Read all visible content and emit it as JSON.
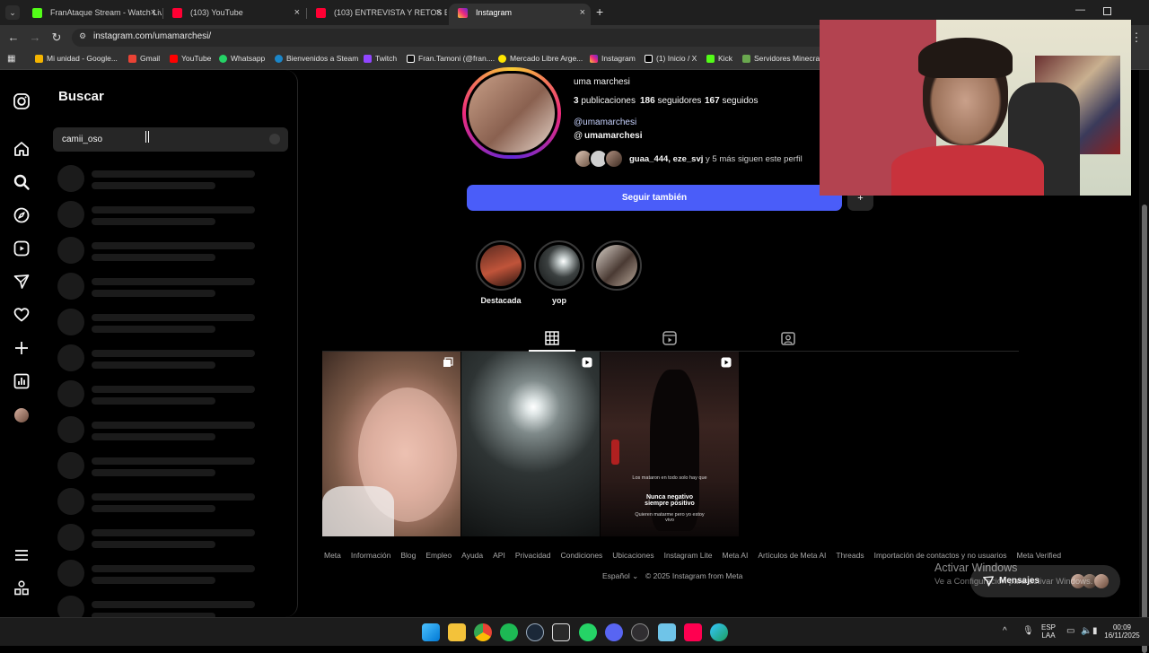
{
  "browser": {
    "tabs": [
      {
        "label": "FranAtaque Stream - Watch Liv",
        "color": "#53fc18"
      },
      {
        "label": "(103) YouTube",
        "color": "#ff0033"
      },
      {
        "label": "(103) ENTREVISTA Y RETOS EN",
        "color": "#ff0033"
      },
      {
        "label": "Instagram",
        "color": "#e1306c"
      }
    ],
    "url": "instagram.com/umamarchesi/",
    "bookmarks": [
      {
        "label": "Mi unidad - Google...",
        "color": "#f4b400"
      },
      {
        "label": "Gmail",
        "color": "#ea4335"
      },
      {
        "label": "YouTube",
        "color": "#ff0000"
      },
      {
        "label": "Whatsapp",
        "color": "#25d366"
      },
      {
        "label": "Bienvenidos a Steam",
        "color": "#1b86c8"
      },
      {
        "label": "Twitch",
        "color": "#9146ff"
      },
      {
        "label": "Fran.Tamoni (@fran....",
        "color": "#ffffff"
      },
      {
        "label": "Mercado Libre Arge...",
        "color": "#ffe600"
      },
      {
        "label": "Instagram",
        "color": "#e1306c"
      },
      {
        "label": "(1) Inicio / X",
        "color": "#ffffff"
      },
      {
        "label": "Kick",
        "color": "#53fc18"
      },
      {
        "label": "Servidores Minecraf...",
        "color": "#6aa84f"
      }
    ]
  },
  "search": {
    "title": "Buscar",
    "query": "camii_oso"
  },
  "profile": {
    "name": "uma marchesi",
    "posts_count": "3",
    "posts_label": "publicaciones",
    "followers_count": "186",
    "followers_label": "seguidores",
    "following_count": "167",
    "following_label": "seguidos",
    "link": "@umamarchesi",
    "threads_handle": "umamarchesi",
    "followed_by_names": "guaa_444, eze_svj",
    "followed_by_rest": " y 5 más siguen este perfil",
    "follow_button": "Seguir también",
    "highlights": [
      {
        "label": "Destacada"
      },
      {
        "label": "yop"
      },
      {
        "label": ""
      }
    ],
    "post2_caption_small": "Los mataron en todo solo hay que",
    "post2_caption_big": "Nunca negativo siempre positivo",
    "post2_caption_small2": "Quieren matarme pero yo estoy vivo"
  },
  "footer": {
    "links": [
      "Meta",
      "Información",
      "Blog",
      "Empleo",
      "Ayuda",
      "API",
      "Privacidad",
      "Condiciones",
      "Ubicaciones",
      "Instagram Lite",
      "Meta AI",
      "Artículos de Meta AI",
      "Threads",
      "Importación de contactos y no usuarios",
      "Meta Verified"
    ],
    "language": "Español",
    "copyright": "© 2025 Instagram from Meta"
  },
  "messages": {
    "label": "Mensajes"
  },
  "activation": {
    "line1": "Activar Windows",
    "line2": "Ve a Configuración para activar Windows."
  },
  "system": {
    "lang1": "ESP",
    "lang2": "LAA",
    "time": "00:09",
    "date": "16/11/2025"
  }
}
